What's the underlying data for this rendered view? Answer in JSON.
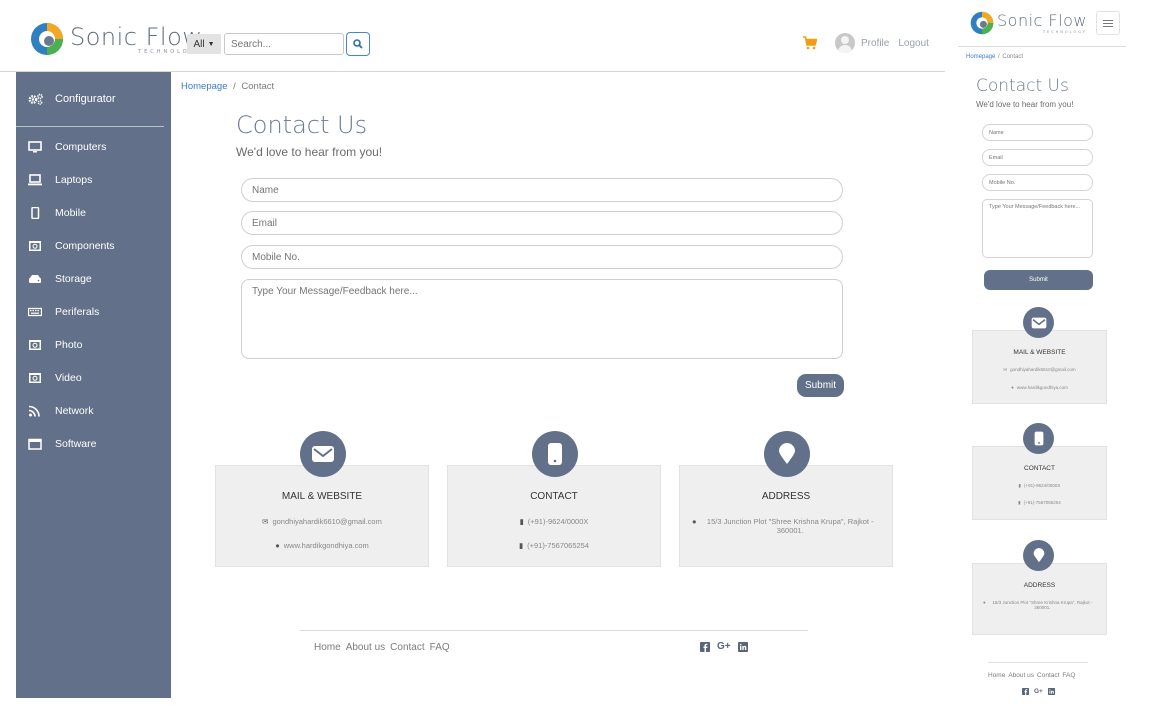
{
  "brand": {
    "name": "Sonic Flow",
    "tagline": "TECHNOLOGY"
  },
  "search": {
    "category": "All",
    "placeholder": "Search..."
  },
  "header": {
    "profile_label": "Profile",
    "logout_label": "Logout"
  },
  "sidebar": {
    "configurator": "Configurator",
    "items": [
      {
        "label": "Computers",
        "icon": "monitor-icon"
      },
      {
        "label": "Laptops",
        "icon": "laptop-icon"
      },
      {
        "label": "Mobile",
        "icon": "mobile-icon"
      },
      {
        "label": "Components",
        "icon": "component-icon"
      },
      {
        "label": "Storage",
        "icon": "storage-icon"
      },
      {
        "label": "Periferals",
        "icon": "keyboard-icon"
      },
      {
        "label": "Photo",
        "icon": "camera-icon"
      },
      {
        "label": "Video",
        "icon": "video-icon"
      },
      {
        "label": "Network",
        "icon": "network-icon"
      },
      {
        "label": "Software",
        "icon": "window-icon"
      }
    ]
  },
  "breadcrumb": {
    "home": "Homepage",
    "separator": "/",
    "current": "Contact"
  },
  "contact": {
    "title": "Contact Us",
    "subtitle": "We'd love to hear from you!",
    "name_placeholder": "Name",
    "email_placeholder": "Email",
    "mobile_placeholder": "Mobile No.",
    "message_placeholder": "Type Your Message/Feedback here...",
    "submit_label": "Submit"
  },
  "cards": {
    "mail": {
      "title": "MAIL & WEBSITE",
      "email": "gondhiyahardik6610@gmail.com",
      "website": "www.hardikgondhiya.com"
    },
    "contact": {
      "title": "CONTACT",
      "phone1": "(+91)-9624/0000X",
      "phone2": "(+91)-7567065254"
    },
    "address": {
      "title": "ADDRESS",
      "text": "15/3 Junction Plot \"Shree Krishna Krupa\", Rajkot - 360001."
    }
  },
  "footer": {
    "links": [
      "Home",
      "About us",
      "Contact",
      "FAQ"
    ],
    "social": [
      "facebook-icon",
      "google-plus-icon",
      "linkedin-icon"
    ],
    "google_plus_label": "G+"
  },
  "colors": {
    "accent": "#627189",
    "link": "#3a7bd5",
    "cart": "#f39c12",
    "card_bg": "#efefef"
  }
}
